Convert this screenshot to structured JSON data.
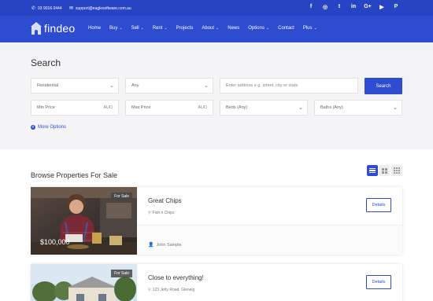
{
  "topbar": {
    "phone": "03 9016 0444",
    "email": "support@eaglesoftware.com.au",
    "social_icons": [
      "facebook-icon",
      "instagram-icon",
      "twitter-icon",
      "linkedin-icon",
      "google-plus-icon",
      "youtube-icon",
      "pinterest-icon"
    ],
    "social_glyphs": [
      "f",
      "◎",
      "t",
      "in",
      "G+",
      "▶",
      "P"
    ]
  },
  "nav": {
    "logo": "findeo",
    "items": [
      {
        "label": "Home",
        "dropdown": false
      },
      {
        "label": "Buy",
        "dropdown": true
      },
      {
        "label": "Sell",
        "dropdown": true
      },
      {
        "label": "Rent",
        "dropdown": true
      },
      {
        "label": "Projects",
        "dropdown": false
      },
      {
        "label": "About",
        "dropdown": true
      },
      {
        "label": "News",
        "dropdown": false
      },
      {
        "label": "Options",
        "dropdown": true
      },
      {
        "label": "Contact",
        "dropdown": false
      },
      {
        "label": "Plus",
        "dropdown": true
      }
    ]
  },
  "search": {
    "title": "Search",
    "property_type": "Residential",
    "any": "Any",
    "address_placeholder": "Enter address e.g. street, city or state",
    "search_button": "Search",
    "min_price": "Min Price",
    "max_price": "Max Price",
    "currency": "AUD",
    "beds": "Beds (Any)",
    "baths": "Baths (Any)",
    "more_options": "More Options"
  },
  "listings": {
    "title": "Browse Properties For Sale",
    "details_label": "Details",
    "cards": [
      {
        "badge": "For Sale",
        "price": "$100,000",
        "title": "Great Chips",
        "address": "Fish n Chips",
        "agent": "John Sample"
      },
      {
        "badge": "For Sale",
        "price": "",
        "title": "Close to everything!",
        "address": "123 Jetty Road, Glenelg",
        "agent": ""
      }
    ]
  },
  "colors": {
    "brand": "#2d4ccf",
    "topbar": "#2744c5"
  }
}
